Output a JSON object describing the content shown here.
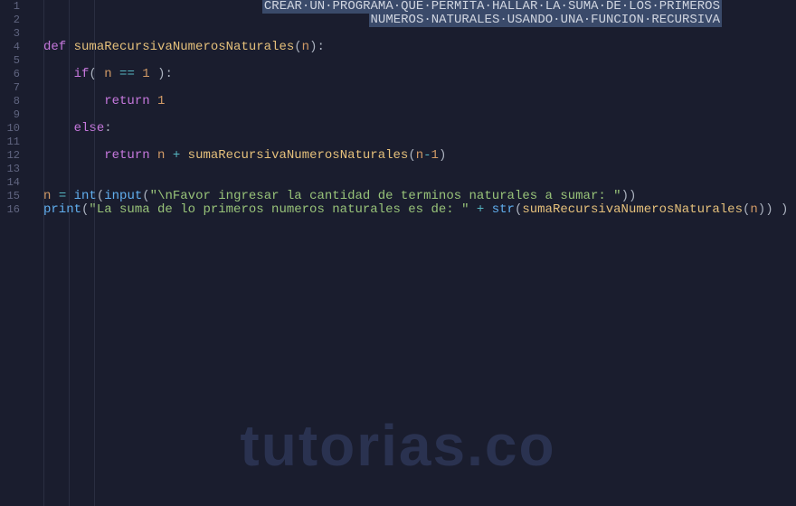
{
  "gutter": {
    "start": 1,
    "end": 16
  },
  "code": {
    "comment1_words": [
      "CREAR",
      "UN",
      "PROGRAMA",
      "QUE",
      "PERMITA",
      "HALLAR",
      "LA",
      "SUMA",
      "DE",
      "LOS",
      "PRIMEROS"
    ],
    "comment2_words": [
      "NUMEROS",
      "NATURALES",
      "USANDO",
      "UNA",
      "FUNCION",
      "RECURSIVA"
    ],
    "def": "def",
    "fn_name": "sumaRecursivaNumerosNaturales",
    "param_n": "n",
    "if": "if",
    "eq": "==",
    "one": "1",
    "return": "return",
    "else": "else",
    "plus": "+",
    "minus": "-",
    "assign": "=",
    "int": "int",
    "input": "input",
    "str1": "\"\\nFavor ingresar la cantidad de terminos naturales a sumar: \"",
    "print": "print",
    "str2": "\"La suma de lo primeros numeros naturales es de: \"",
    "str": "str"
  },
  "watermark": "tutorias.co",
  "colors": {
    "bg": "#1a1d2e",
    "gutter": "#606580",
    "keyword": "#c678dd",
    "function": "#e5c07b",
    "number": "#d19a66",
    "string": "#98c379",
    "builtin": "#61afef",
    "comment_bg": "#3a4a6a"
  }
}
